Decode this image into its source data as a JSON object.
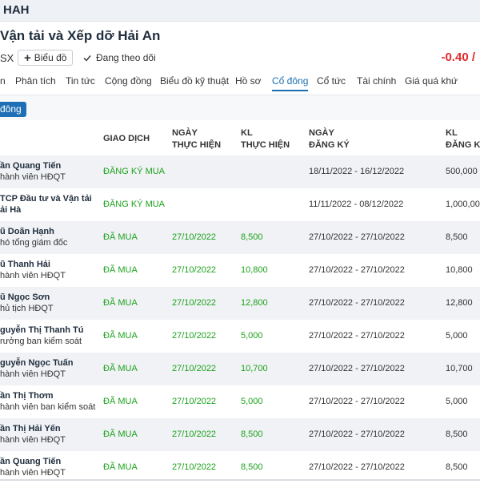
{
  "header": {
    "ticker": "HAH"
  },
  "company": {
    "name": "Vận tải và Xếp dỡ Hải An",
    "exchange": "SX",
    "price_change": "-0.40 /"
  },
  "actions": {
    "chart_label": "Biểu đồ",
    "follow_label": "Đang theo dõi"
  },
  "tabs": [
    {
      "label": "n"
    },
    {
      "label": "Phân tích"
    },
    {
      "label": "Tin tức"
    },
    {
      "label": "Cộng đồng"
    },
    {
      "label": "Biểu đồ kỹ thuật"
    },
    {
      "label": "Hồ sơ"
    },
    {
      "label": "Cổ đông"
    },
    {
      "label": "Cổ tức"
    },
    {
      "label": "Tài chính"
    },
    {
      "label": "Giá quá khứ"
    }
  ],
  "section_badge": "đông",
  "table": {
    "headers": {
      "transaction": "GIAO DỊCH",
      "exec_date_1": "NGÀY",
      "exec_date_2": "THỰC HIỆN",
      "exec_vol_1": "KL",
      "exec_vol_2": "THỰC HIỆN",
      "reg_date_1": "NGÀY",
      "reg_date_2": "ĐĂNG KÝ",
      "reg_vol_1": "KL",
      "reg_vol_2": "ĐĂNG K"
    },
    "rows": [
      {
        "name": "ần Quang Tiến",
        "role": "hành viên HĐQT",
        "transaction": "ĐĂNG KÝ MUA",
        "exec_date": "",
        "exec_vol": "",
        "reg_period": "18/11/2022 - 16/12/2022",
        "reg_vol": "500,000"
      },
      {
        "name": "TCP Đầu tư và Vận tải",
        "role": "ải Hà",
        "transaction": "ĐĂNG KÝ MUA",
        "exec_date": "",
        "exec_vol": "",
        "reg_period": "11/11/2022 - 08/12/2022",
        "reg_vol": "1,000,00"
      },
      {
        "name": "ũ Doãn Hạnh",
        "role": "hó tổng giám đốc",
        "transaction": "ĐÃ MUA",
        "exec_date": "27/10/2022",
        "exec_vol": "8,500",
        "reg_period": "27/10/2022 - 27/10/2022",
        "reg_vol": "8,500"
      },
      {
        "name": "ũ Thanh Hải",
        "role": "hành viên HĐQT",
        "transaction": "ĐÃ MUA",
        "exec_date": "27/10/2022",
        "exec_vol": "10,800",
        "reg_period": "27/10/2022 - 27/10/2022",
        "reg_vol": "10,800"
      },
      {
        "name": "ũ Ngọc Sơn",
        "role": "hủ tịch HĐQT",
        "transaction": "ĐÃ MUA",
        "exec_date": "27/10/2022",
        "exec_vol": "12,800",
        "reg_period": "27/10/2022 - 27/10/2022",
        "reg_vol": "12,800"
      },
      {
        "name": "guyễn Thị Thanh Tú",
        "role": "rưởng ban kiểm soát",
        "transaction": "ĐÃ MUA",
        "exec_date": "27/10/2022",
        "exec_vol": "5,000",
        "reg_period": "27/10/2022 - 27/10/2022",
        "reg_vol": "5,000"
      },
      {
        "name": "guyễn Ngọc Tuấn",
        "role": "hành viên HĐQT",
        "transaction": "ĐÃ MUA",
        "exec_date": "27/10/2022",
        "exec_vol": "10,700",
        "reg_period": "27/10/2022 - 27/10/2022",
        "reg_vol": "10,700"
      },
      {
        "name": "ần Thị Thơm",
        "role": "hành viên ban kiểm soát",
        "transaction": "ĐÃ MUA",
        "exec_date": "27/10/2022",
        "exec_vol": "5,000",
        "reg_period": "27/10/2022 - 27/10/2022",
        "reg_vol": "5,000"
      },
      {
        "name": "ần Thị Hải Yến",
        "role": "hành viên HĐQT",
        "transaction": "ĐÃ MUA",
        "exec_date": "27/10/2022",
        "exec_vol": "8,500",
        "reg_period": "27/10/2022 - 27/10/2022",
        "reg_vol": "8,500"
      },
      {
        "name": "ần Quang Tiến",
        "role": "hành viên HĐQT",
        "transaction": "ĐÃ MUA",
        "exec_date": "27/10/2022",
        "exec_vol": "8,500",
        "reg_period": "27/10/2022 - 27/10/2022",
        "reg_vol": "8,500"
      }
    ]
  },
  "colors": {
    "accent": "#1a6fb3",
    "positive": "#1ca21c",
    "negative": "#e02b2b"
  },
  "icons": {
    "chart_button": "plus-icon",
    "follow": "check-icon"
  }
}
